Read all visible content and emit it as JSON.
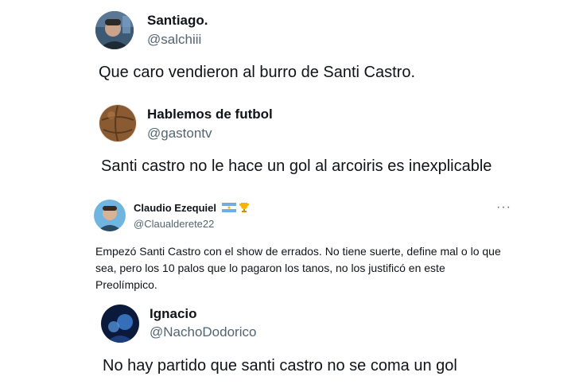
{
  "tweets": [
    {
      "name": "Santiago.",
      "handle": "@salchiii",
      "text": "Que caro vendieron al burro de Santi Castro."
    },
    {
      "name": "Hablemos de futbol",
      "handle": "@gastontv",
      "text": "Santi castro no le hace un gol al arcoiris es inexplicable"
    },
    {
      "name": "Claudio Ezequiel",
      "handle": "@Claualderete22",
      "text": "Empezó Santi Castro con el show de errados. No tiene suerte, define mal o lo que sea, pero los 10 palos que lo pagaron los tanos, no los justificó en este Preolímpico.",
      "badges": [
        "argentina-flag-icon",
        "trophy-icon"
      ],
      "more_label": "···"
    },
    {
      "name": "Ignacio",
      "handle": "@NachoDodorico",
      "text": "No hay partido que santi castro no se coma un gol"
    }
  ],
  "colors": {
    "text": "#0f1419",
    "secondary": "#536471"
  }
}
